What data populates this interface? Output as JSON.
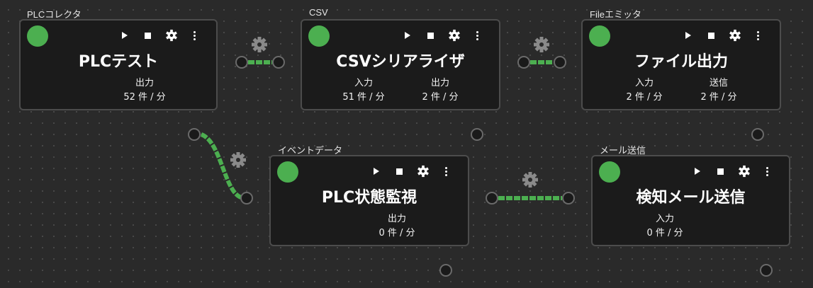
{
  "colors": {
    "accent": "#4caf50",
    "node_bg": "#1b1b1b",
    "canvas_bg": "#2a2a2a"
  },
  "nodes": {
    "plc": {
      "label": "PLCコレクタ",
      "title": "PLCテスト",
      "out_label": "出力",
      "out_value": "52 件 / 分"
    },
    "csv": {
      "label": "CSV",
      "title": "CSVシリアライザ",
      "in_label": "入力",
      "in_value": "51 件 / 分",
      "out_label": "出力",
      "out_value": "2 件 / 分"
    },
    "file": {
      "label": "Fileエミッタ",
      "title": "ファイル出力",
      "in_label": "入力",
      "in_value": "2 件 / 分",
      "out_label": "送信",
      "out_value": "2 件 / 分"
    },
    "event": {
      "label": "イベントデータ",
      "title": "PLC状態監視",
      "out_label": "出力",
      "out_value": "0 件 / 分"
    },
    "mail": {
      "label": "メール送信",
      "title": "検知メール送信",
      "in_label": "入力",
      "in_value": "0 件 / 分"
    }
  },
  "icons": [
    "play-icon",
    "stop-icon",
    "gear-icon",
    "kebab-menu-icon"
  ]
}
